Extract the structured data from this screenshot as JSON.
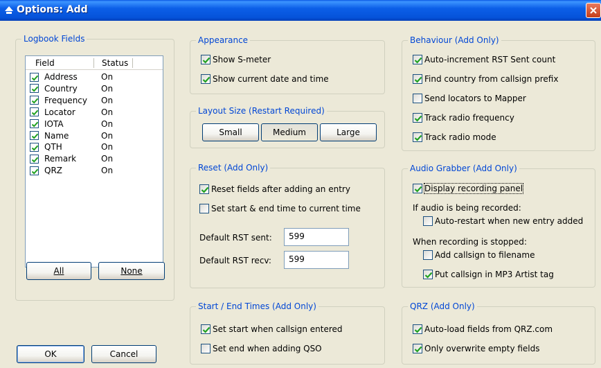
{
  "window": {
    "title": "Options: Add"
  },
  "logbook": {
    "title": "Logbook Fields",
    "col_field": "Field",
    "col_status": "Status",
    "rows": [
      {
        "field": "Address",
        "status": "On",
        "checked": true
      },
      {
        "field": "Country",
        "status": "On",
        "checked": true
      },
      {
        "field": "Frequency",
        "status": "On",
        "checked": true
      },
      {
        "field": "Locator",
        "status": "On",
        "checked": true
      },
      {
        "field": "IOTA",
        "status": "On",
        "checked": true
      },
      {
        "field": "Name",
        "status": "On",
        "checked": true
      },
      {
        "field": "QTH",
        "status": "On",
        "checked": true
      },
      {
        "field": "Remark",
        "status": "On",
        "checked": true
      },
      {
        "field": "QRZ",
        "status": "On",
        "checked": true
      }
    ],
    "all_label": "All",
    "none_label": "None"
  },
  "appearance": {
    "title": "Appearance",
    "show_smeter": "Show S-meter",
    "show_datetime": "Show current date and time"
  },
  "layout": {
    "title": "Layout Size (Restart Required)",
    "small": "Small",
    "medium": "Medium",
    "large": "Large",
    "selected": "Medium"
  },
  "reset": {
    "title": "Reset (Add Only)",
    "reset_fields": "Reset fields after adding an entry",
    "set_start_end": "Set start & end time to current time",
    "rst_sent_label": "Default RST sent:",
    "rst_sent_value": "599",
    "rst_recv_label": "Default RST recv:",
    "rst_recv_value": "599"
  },
  "startend": {
    "title": "Start / End Times (Add Only)",
    "set_start": "Set start when callsign entered",
    "set_end": "Set end when adding QSO"
  },
  "behaviour": {
    "title": "Behaviour (Add Only)",
    "auto_inc": "Auto-increment RST Sent count",
    "find_country": "Find country from callsign prefix",
    "send_locators": "Send locators to Mapper",
    "track_freq": "Track radio frequency",
    "track_mode": "Track radio mode"
  },
  "audio": {
    "title": "Audio Grabber (Add Only)",
    "display_panel": "Display recording panel",
    "if_recorded": "If audio is being recorded:",
    "auto_restart": "Auto-restart when new entry added",
    "when_stopped": "When recording is stopped:",
    "add_callsign": "Add callsign to filename",
    "put_callsign": "Put callsign in MP3 Artist tag"
  },
  "qrz": {
    "title": "QRZ (Add Only)",
    "auto_load": "Auto-load fields from QRZ.com",
    "overwrite": "Only overwrite empty fields"
  },
  "footer": {
    "ok": "OK",
    "cancel": "Cancel"
  },
  "colors": {
    "group_title": "#0046d5",
    "titlebar": "#0552d9",
    "face": "#ece9d8"
  }
}
